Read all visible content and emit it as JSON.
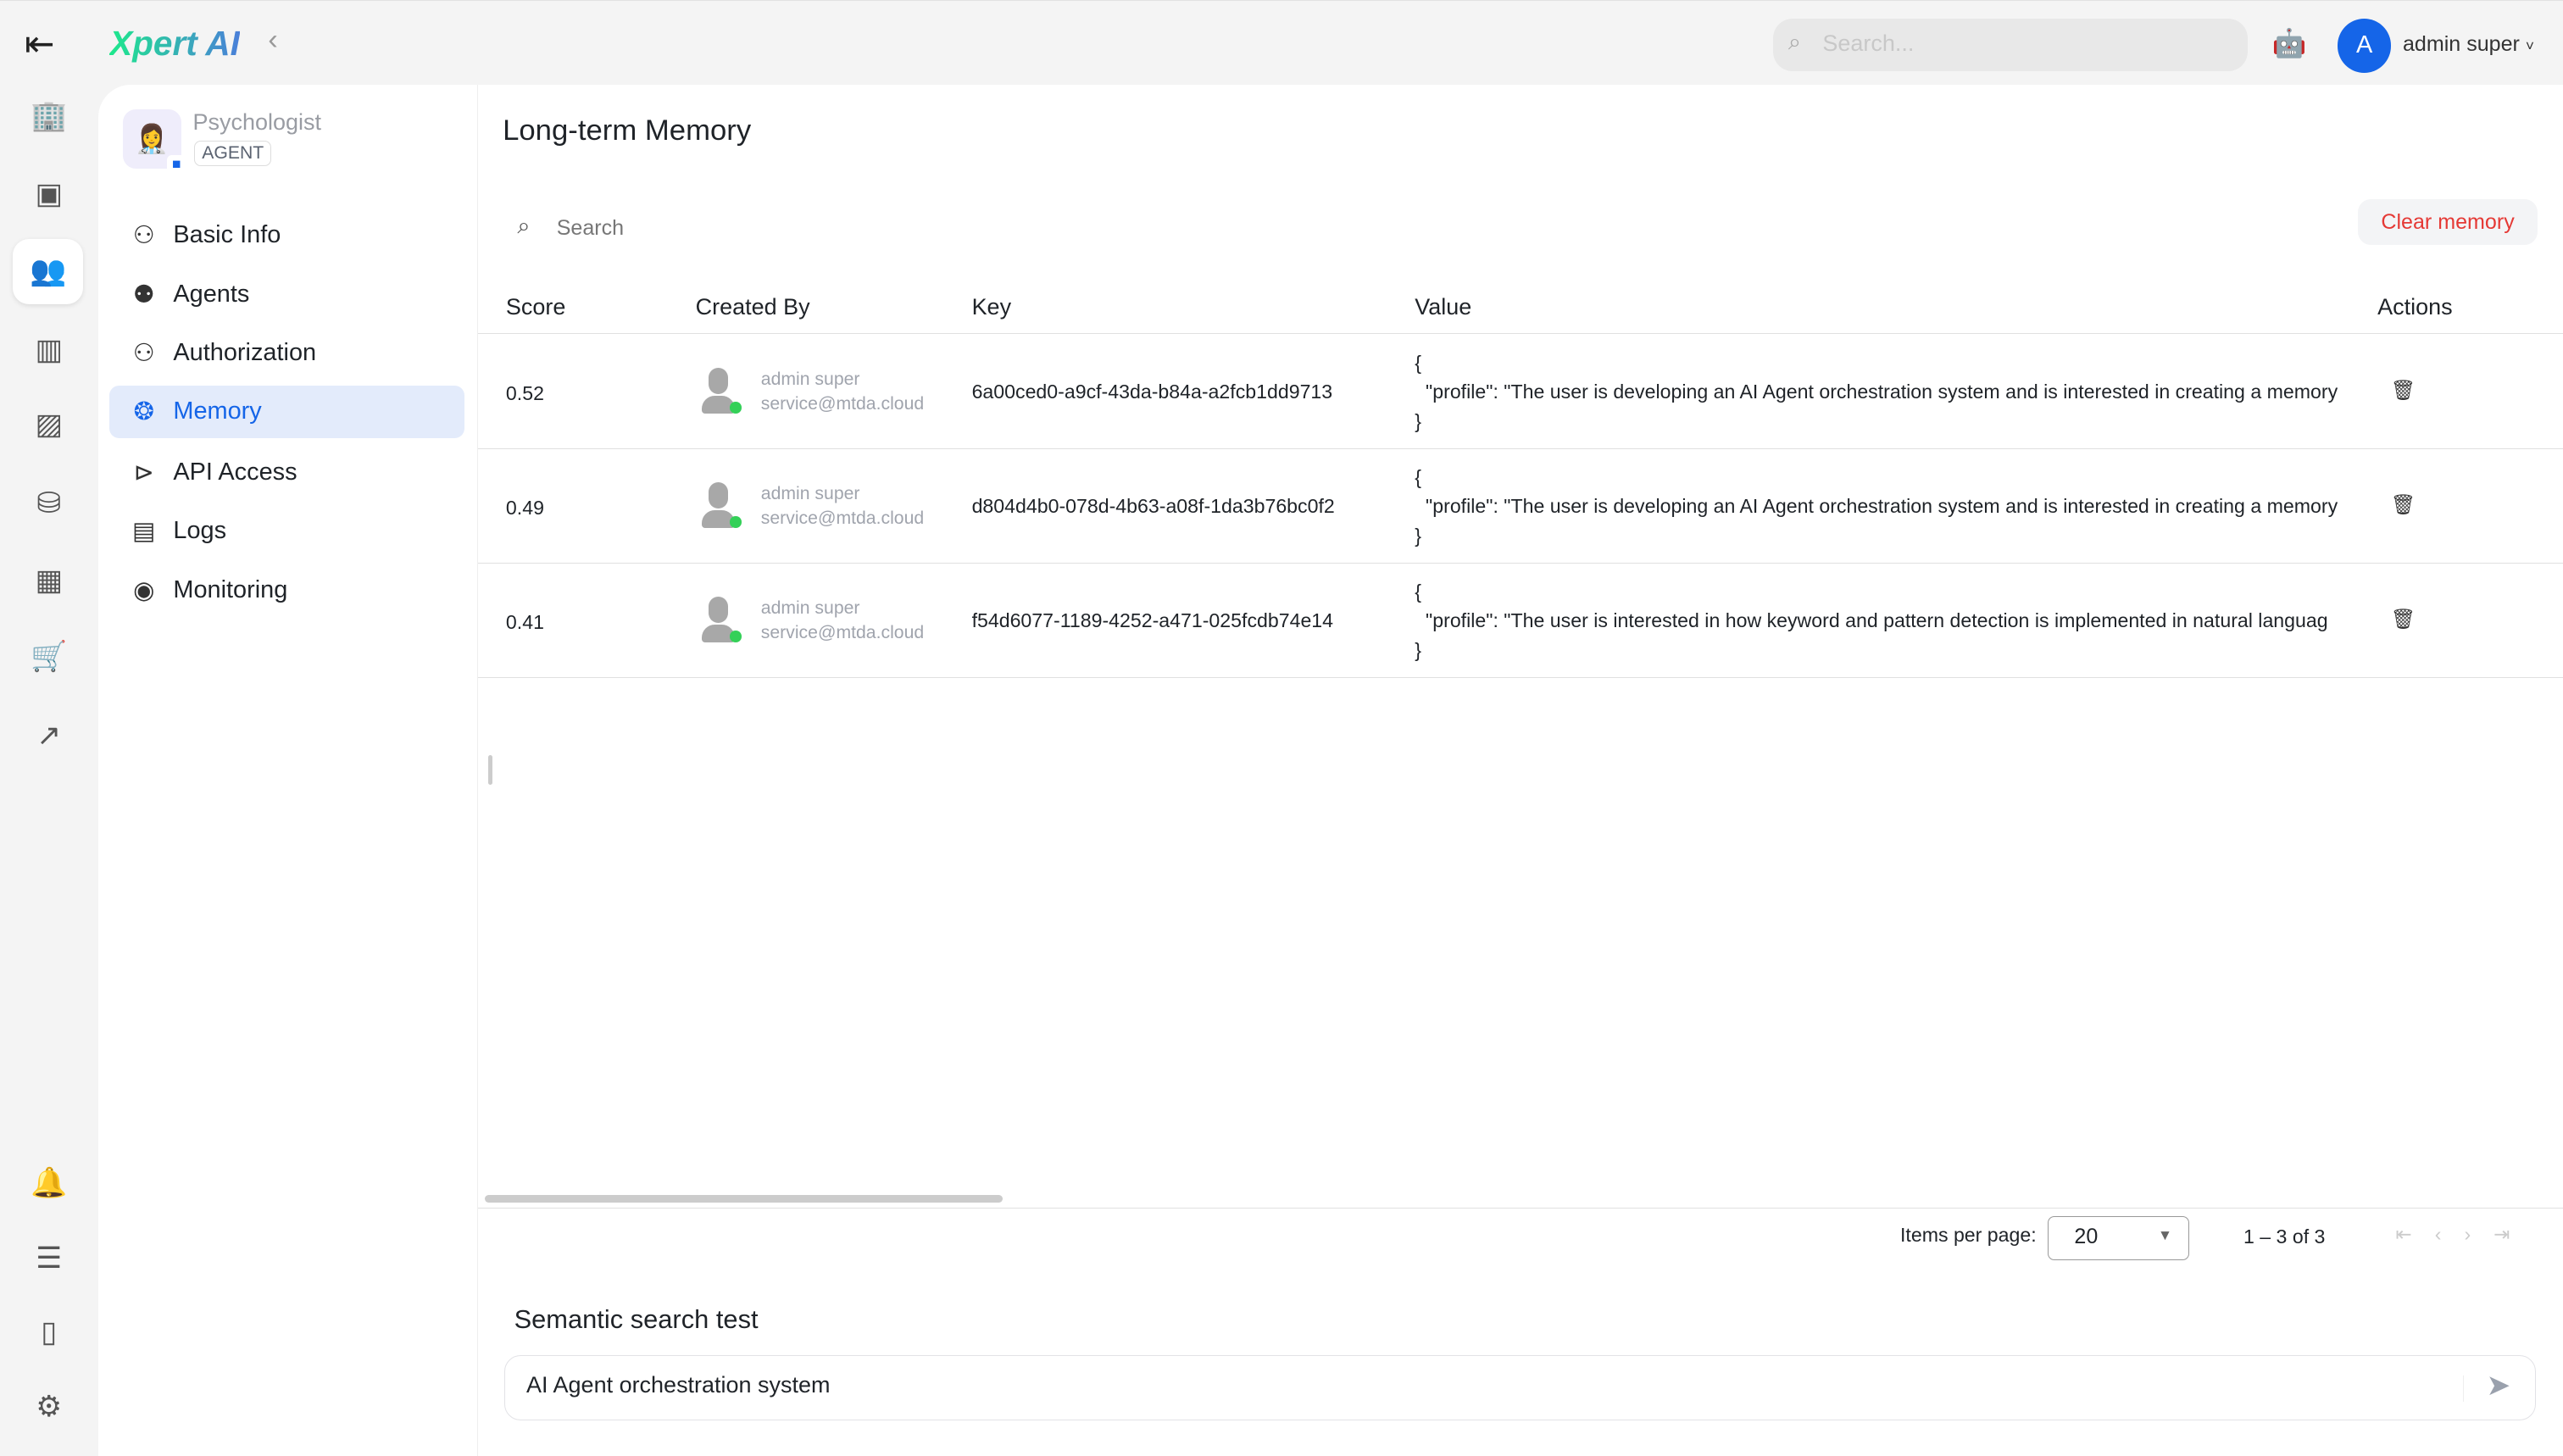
{
  "brand": {
    "logo": "Xpert AI"
  },
  "topbar": {
    "search_placeholder": "Search...",
    "user_initial": "A",
    "user_name": "admin super",
    "avatar_color": "#1565e8"
  },
  "rail": {
    "items": [
      "organization",
      "agents",
      "xpert-agents",
      "analytics",
      "images",
      "database",
      "dashboards",
      "store",
      "trends"
    ],
    "bottom": [
      "notifications",
      "settings-sliders",
      "remote",
      "gear"
    ]
  },
  "agent": {
    "name": "Psychologist",
    "badge": "AGENT",
    "emoji": "👩‍⚕️"
  },
  "nav": [
    {
      "label": "Basic Info",
      "icon": "user-icon"
    },
    {
      "label": "Agents",
      "icon": "people-icon"
    },
    {
      "label": "Authorization",
      "icon": "user-plus-icon"
    },
    {
      "label": "Memory",
      "icon": "brain-icon",
      "active": true
    },
    {
      "label": "API Access",
      "icon": "terminal-icon"
    },
    {
      "label": "Logs",
      "icon": "log-icon"
    },
    {
      "label": "Monitoring",
      "icon": "gauge-icon"
    }
  ],
  "main": {
    "title": "Long-term Memory",
    "search_placeholder": "Search",
    "clear_label": "Clear memory",
    "columns": [
      "Score",
      "Created By",
      "Key",
      "Value",
      "Actions"
    ],
    "rows": [
      {
        "score": "0.52",
        "name": "admin super",
        "email": "service@mtda.cloud",
        "key": "6a00ced0-a9cf-43da-b84a-a2fcb1dd9713",
        "value": "{\n  \"profile\": \"The user is developing an AI Agent orchestration system and is interested in creating a memory\n}"
      },
      {
        "score": "0.49",
        "name": "admin super",
        "email": "service@mtda.cloud",
        "key": "d804d4b0-078d-4b63-a08f-1da3b76bc0f2",
        "value": "{\n  \"profile\": \"The user is developing an AI Agent orchestration system and is interested in creating a memory\n}"
      },
      {
        "score": "0.41",
        "name": "admin super",
        "email": "service@mtda.cloud",
        "key": "f54d6077-1189-4252-a471-025fcdb74e14",
        "value": "{\n  \"profile\": \"The user is interested in how keyword and pattern detection is implemented in natural languag\n}"
      }
    ],
    "paginator": {
      "label": "Items per page:",
      "page_size": "20",
      "range": "1 – 3 of 3"
    },
    "semantic": {
      "title": "Semantic search test",
      "query": "AI Agent orchestration system"
    }
  },
  "colors": {
    "accent": "#1565e8",
    "danger": "#e53935",
    "online": "#34d058"
  }
}
